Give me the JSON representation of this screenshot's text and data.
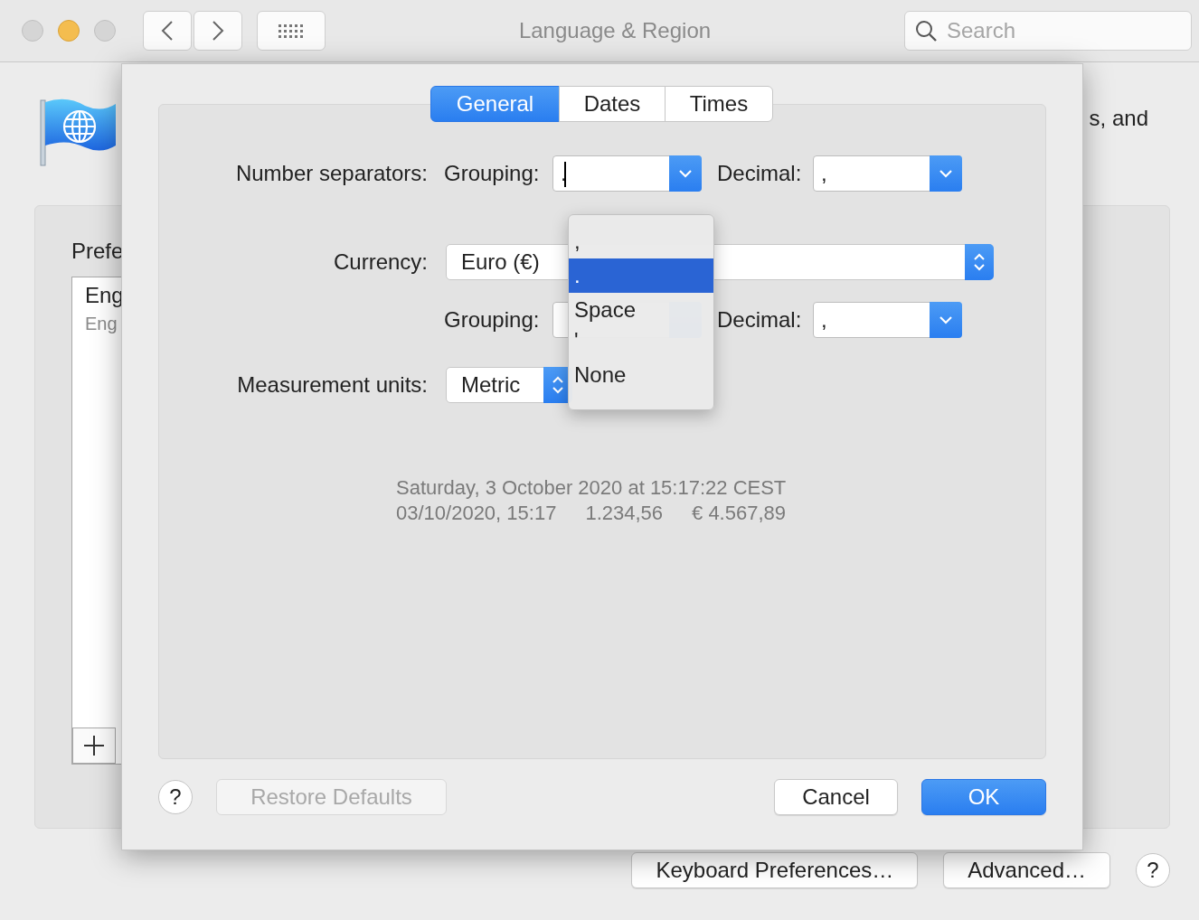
{
  "window": {
    "title": "Language & Region",
    "search": {
      "placeholder": "Search"
    }
  },
  "background": {
    "intro_text": "s, and",
    "panel_heading": "Prefe",
    "languages": [
      {
        "name": "Eng",
        "subtitle": "Eng"
      }
    ],
    "buttons": [
      "Keyboard Preferences…",
      "Advanced…"
    ],
    "help": "?"
  },
  "sheet": {
    "tabs": [
      {
        "label": "General",
        "selected": true
      },
      {
        "label": "Dates",
        "selected": false
      },
      {
        "label": "Times",
        "selected": false
      }
    ],
    "number_separators": {
      "label": "Number separators:",
      "grouping_label": "Grouping:",
      "grouping_value": ".",
      "decimal_label": "Decimal:",
      "decimal_value": ","
    },
    "currency": {
      "label": "Currency:",
      "value": "Euro (€)"
    },
    "currency_separators": {
      "grouping_label": "Grouping:",
      "decimal_label": "Decimal:",
      "decimal_value": ","
    },
    "measurement_units": {
      "label": "Measurement units:",
      "value": "Metric"
    },
    "sample_lines": [
      [
        "Saturday, 3 October 2020 at 15:17:22 CEST"
      ],
      [
        "03/10/2020, 15:17",
        "1.234,56",
        "€ 4.567,89"
      ]
    ],
    "buttons": [
      {
        "label": "Restore Defaults",
        "disabled": true,
        "default": false
      },
      {
        "label": "Cancel",
        "disabled": false,
        "default": false
      },
      {
        "label": "OK",
        "disabled": false,
        "default": true
      }
    ],
    "help": "?"
  },
  "grouping_menu": {
    "items": [
      {
        "label": ",",
        "selected": false
      },
      {
        "label": ".",
        "selected": true
      },
      {
        "label": "Space",
        "selected": false
      },
      {
        "label": "'",
        "selected": false
      },
      {
        "label": "None",
        "selected": false
      }
    ]
  }
}
